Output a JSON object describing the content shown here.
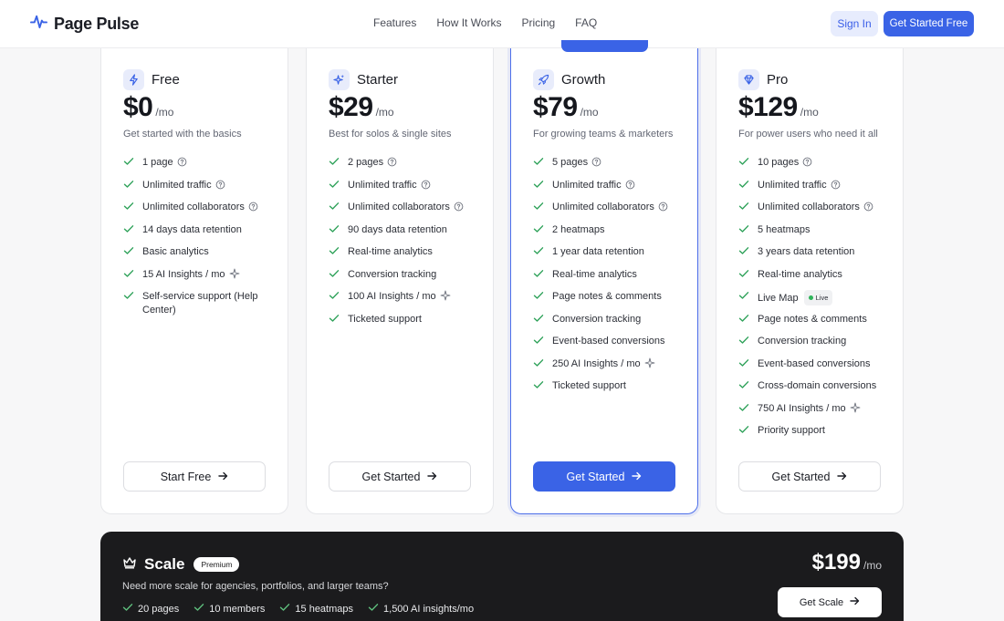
{
  "brand": {
    "name": "Page Pulse"
  },
  "nav": {
    "items": [
      "Features",
      "How It Works",
      "Pricing",
      "FAQ"
    ]
  },
  "header": {
    "sign_in": "Sign In",
    "get_started": "Get Started Free"
  },
  "plans": [
    {
      "name": "Free",
      "icon": "lightning-icon",
      "price": "$0",
      "per": "/mo",
      "desc": "Get started with the basics",
      "button": "Start Free",
      "features": [
        "1 page",
        "Unlimited traffic",
        "Unlimited collaborators",
        "14 days data retention",
        "Basic analytics",
        "15 AI Insights / mo",
        "Self-service support (Help Center)"
      ]
    },
    {
      "name": "Starter",
      "icon": "sparkle-icon",
      "price": "$29",
      "per": "/mo",
      "desc": "Best for solos & single sites",
      "button": "Get Started",
      "features": [
        "2 pages",
        "Unlimited traffic",
        "Unlimited collaborators",
        "90 days data retention",
        "Real-time analytics",
        "Conversion tracking",
        "100 AI Insights / mo",
        "Ticketed support"
      ]
    },
    {
      "name": "Growth",
      "icon": "rocket-icon",
      "price": "$79",
      "per": "/mo",
      "desc": "For growing teams & marketers",
      "button": "Get Started",
      "features": [
        "5 pages",
        "Unlimited traffic",
        "Unlimited collaborators",
        "2 heatmaps",
        "1 year data retention",
        "Real-time analytics",
        "Page notes & comments",
        "Conversion tracking",
        "Event-based conversions",
        "250 AI Insights / mo",
        "Ticketed support"
      ]
    },
    {
      "name": "Pro",
      "icon": "diamond-icon",
      "price": "$129",
      "per": "/mo",
      "desc": "For power users who need it all",
      "button": "Get Started",
      "features": [
        "10 pages",
        "Unlimited traffic",
        "Unlimited collaborators",
        "5 heatmaps",
        "3 years data retention",
        "Real-time analytics",
        "Live Map",
        "Page notes & comments",
        "Conversion tracking",
        "Event-based conversions",
        "Cross-domain conversions",
        "750 AI Insights / mo",
        "Priority support"
      ]
    }
  ],
  "live_badge": "Live",
  "scale": {
    "title": "Scale",
    "badge": "Premium",
    "desc": "Need more scale for agencies, portfolios, and larger teams?",
    "price": "$199",
    "per": "/mo",
    "button": "Get Scale",
    "features": [
      "20 pages",
      "10 members",
      "15 heatmaps",
      "1,500 AI insights/mo"
    ]
  },
  "colors": {
    "accent": "#3a63e6",
    "check": "#2fa25a",
    "dark": "#1b1b1d"
  }
}
